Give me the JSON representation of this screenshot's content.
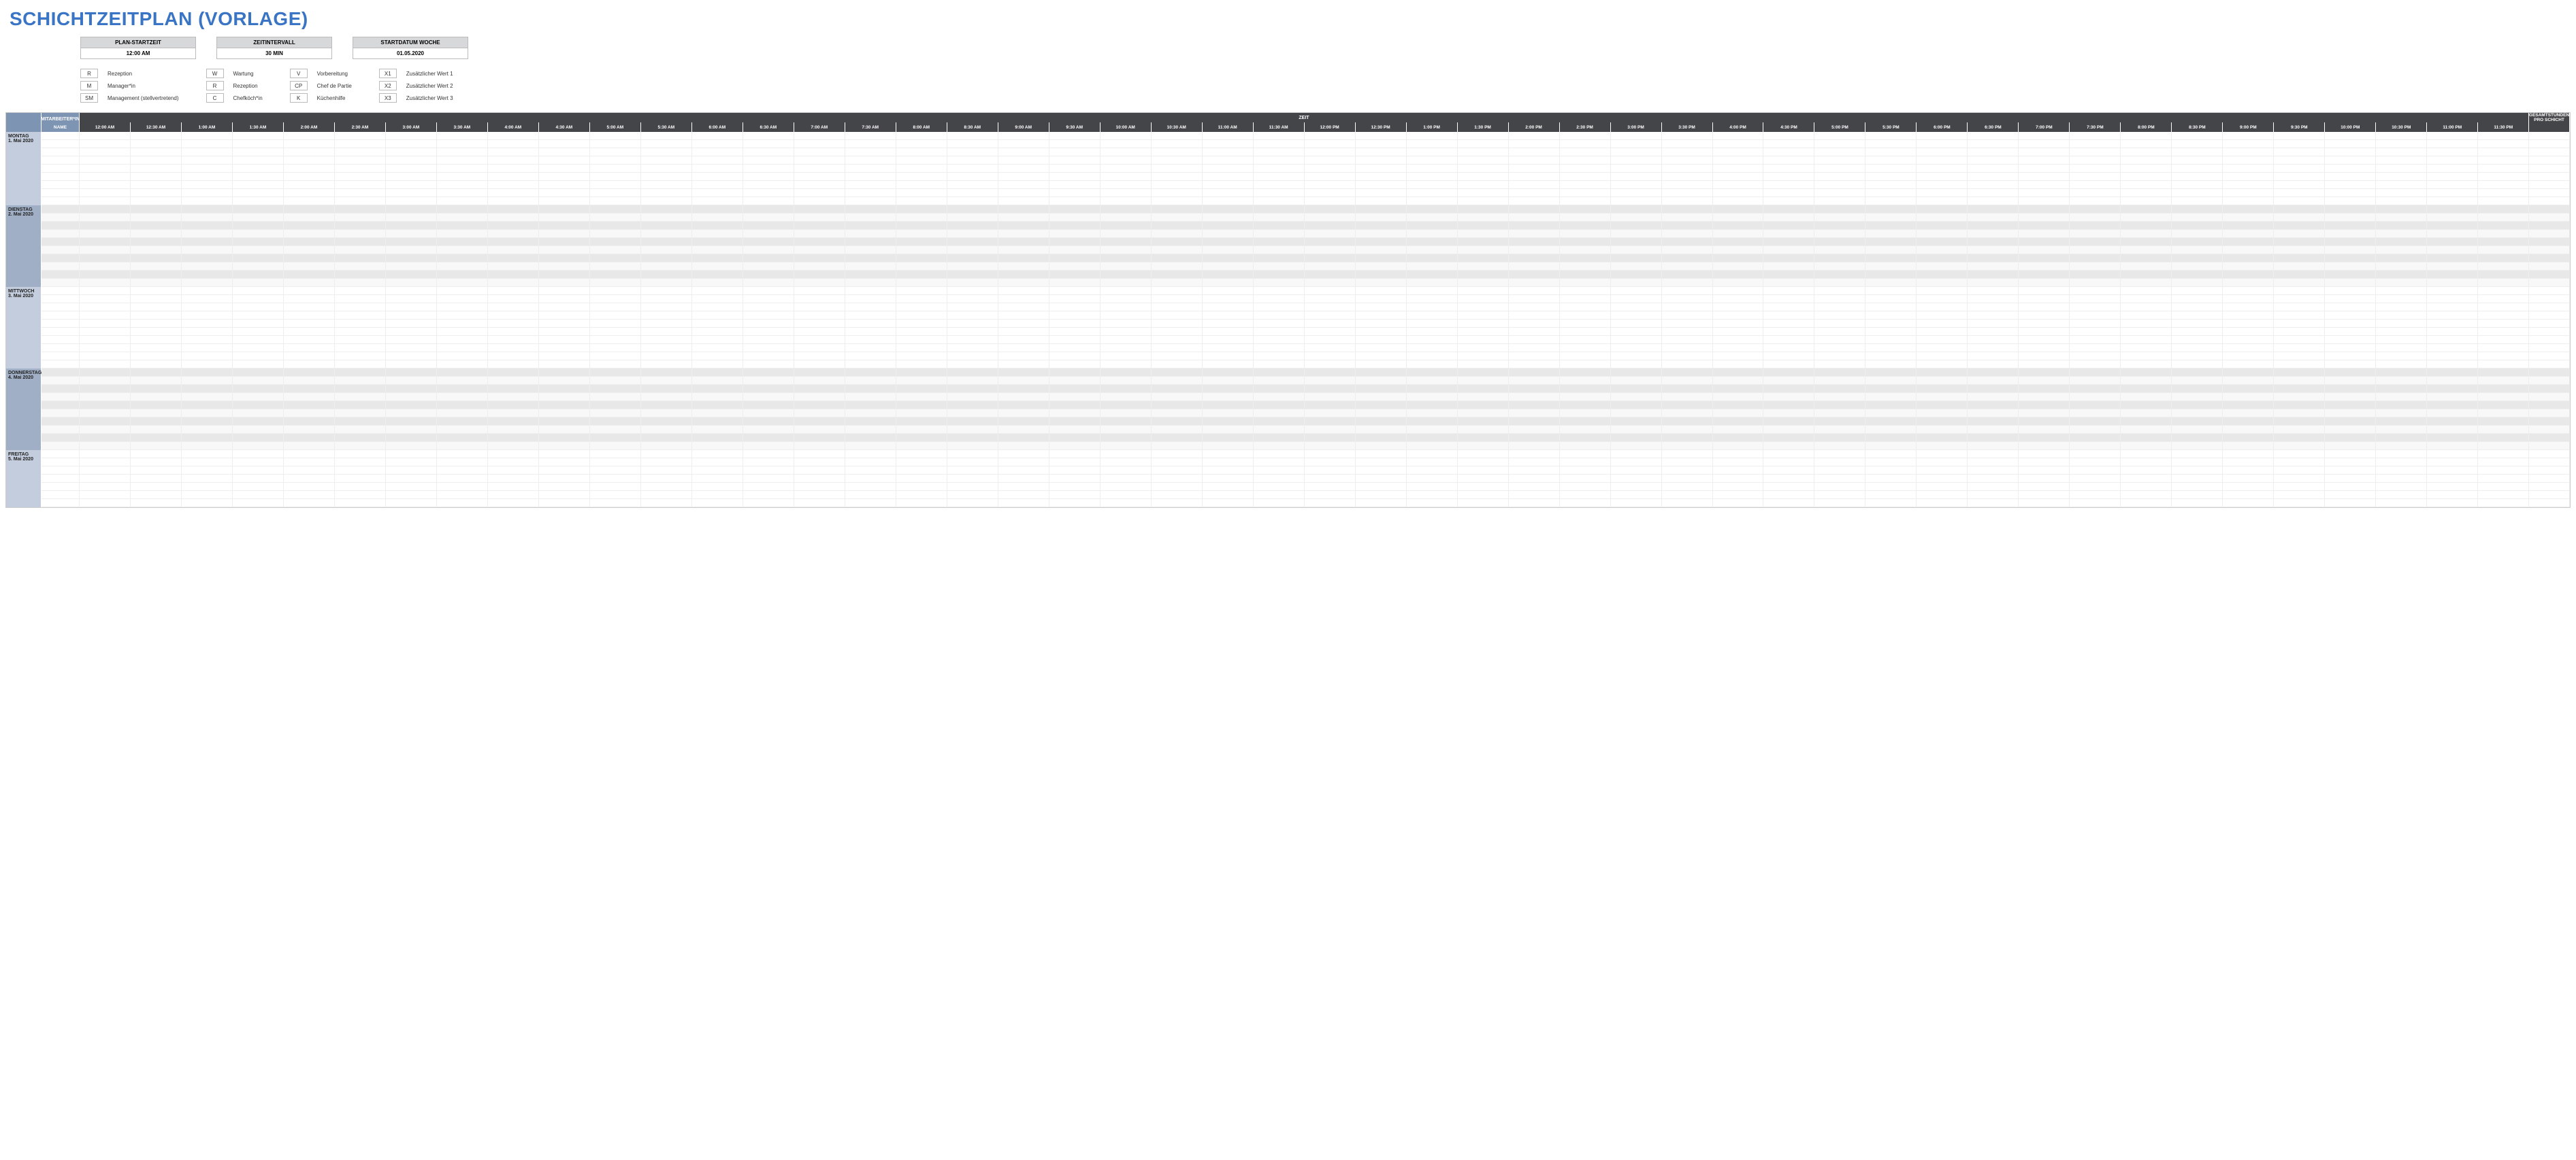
{
  "title": "SCHICHTZEITPLAN (VORLAGE)",
  "params": [
    {
      "label": "PLAN-STARTZEIT",
      "value": "12:00 AM"
    },
    {
      "label": "ZEITINTERVALL",
      "value": "30 MIN"
    },
    {
      "label": "STARTDATUM WOCHE",
      "value": "01.05.2020"
    }
  ],
  "legend": [
    [
      {
        "code": "R",
        "label": "Rezeption"
      },
      {
        "code": "M",
        "label": "Manager*in"
      },
      {
        "code": "SM",
        "label": "Management (stellvertretend)"
      }
    ],
    [
      {
        "code": "W",
        "label": "Wartung"
      },
      {
        "code": "R",
        "label": "Rezeption"
      },
      {
        "code": "C",
        "label": "Chefköch*in"
      }
    ],
    [
      {
        "code": "V",
        "label": "Vorbereitung"
      },
      {
        "code": "CP",
        "label": "Chef de Partie"
      },
      {
        "code": "K",
        "label": "Küchenhilfe"
      }
    ],
    [
      {
        "code": "X1",
        "label": "Zusätzlicher Wert 1"
      },
      {
        "code": "X2",
        "label": "Zusätzlicher Wert 2"
      },
      {
        "code": "X3",
        "label": "Zusätzlicher Wert 3"
      }
    ]
  ],
  "headers": {
    "side_top": "MITARBEITER*IN",
    "side_bottom": "NAME",
    "time_header": "ZEIT",
    "total": "GESAMTSTUNDEN PRO SCHICHT",
    "time_slots": [
      "12:00 AM",
      "12:30 AM",
      "1:00 AM",
      "1:30 AM",
      "2:00 AM",
      "2:30 AM",
      "3:00 AM",
      "3:30 AM",
      "4:00 AM",
      "4:30 AM",
      "5:00 AM",
      "5:30 AM",
      "6:00 AM",
      "6:30 AM",
      "7:00 AM",
      "7:30 AM",
      "8:00 AM",
      "8:30 AM",
      "9:00 AM",
      "9:30 AM",
      "10:00 AM",
      "10:30 AM",
      "11:00 AM",
      "11:30 AM",
      "12:00 PM",
      "12:30 PM",
      "1:00 PM",
      "1:30 PM",
      "2:00 PM",
      "2:30 PM",
      "3:00 PM",
      "3:30 PM",
      "4:00 PM",
      "4:30 PM",
      "5:00 PM",
      "5:30 PM",
      "6:00 PM",
      "6:30 PM",
      "7:00 PM",
      "7:30 PM",
      "8:00 PM",
      "8:30 PM",
      "9:00 PM",
      "9:30 PM",
      "10:00 PM",
      "10:30 PM",
      "11:00 PM",
      "11:30 PM"
    ]
  },
  "days": [
    {
      "name": "MONTAG",
      "date": "1. Mai 2020",
      "rows": 9,
      "shade": false
    },
    {
      "name": "DIENSTAG",
      "date": "2. Mai 2020",
      "rows": 10,
      "shade": true
    },
    {
      "name": "MITTWOCH",
      "date": "3. Mai 2020",
      "rows": 10,
      "shade": false
    },
    {
      "name": "DONNERSTAG",
      "date": "4. Mai 2020",
      "rows": 10,
      "shade": true
    },
    {
      "name": "FREITAG",
      "date": "5. Mai 2020",
      "rows": 7,
      "shade": false
    }
  ]
}
